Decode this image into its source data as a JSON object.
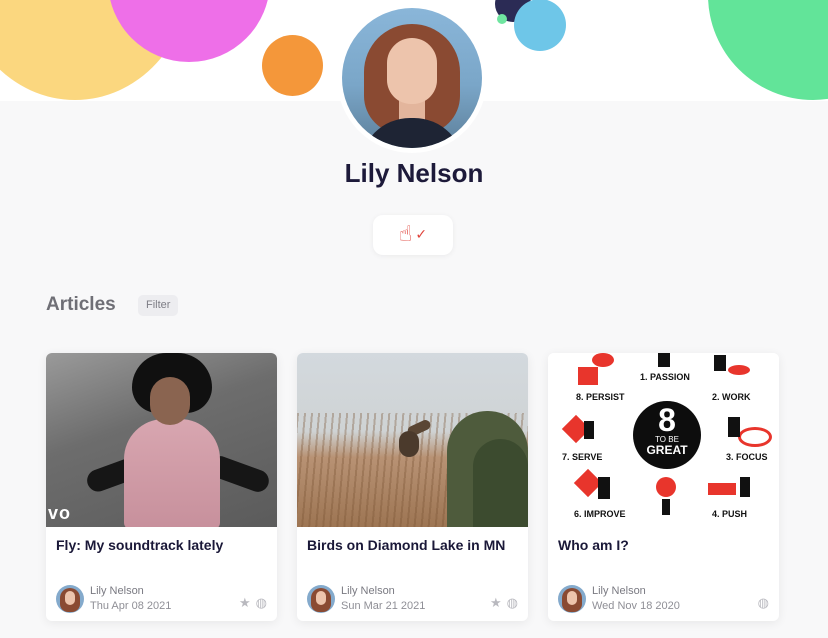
{
  "profile": {
    "name": "Lily Nelson"
  },
  "badges": {
    "hand_icon": "raised-finger-icon",
    "check_icon": "check-icon"
  },
  "articles_section": {
    "title": "Articles",
    "filter_label": "Filter"
  },
  "articles": [
    {
      "title": "Fly: My soundtrack lately",
      "author": "Lily Nelson",
      "date": "Thu Apr 08 2021",
      "thumb_overlay": "vo",
      "icons": [
        "star-icon",
        "globe-icon"
      ]
    },
    {
      "title": "Birds on Diamond Lake in MN",
      "author": "Lily Nelson",
      "date": "Sun Mar 21 2021",
      "icons": [
        "star-icon",
        "globe-icon"
      ]
    },
    {
      "title": "Who am I?",
      "author": "Lily Nelson",
      "date": "Wed Nov 18 2020",
      "icons": [
        "globe-icon"
      ],
      "thumb_text": {
        "center_big": "8",
        "center_mid": "TO BE",
        "center_bottom": "GREAT",
        "steps": [
          "1. PASSION",
          "2. WORK",
          "3. FOCUS",
          "4. PUSH",
          "6. IMPROVE",
          "7. SERVE",
          "8. PERSIST"
        ]
      }
    }
  ],
  "colors": {
    "page_bg": "#f8f8f9",
    "name_color": "#1d1a3a",
    "accent_red": "#e0443c"
  }
}
